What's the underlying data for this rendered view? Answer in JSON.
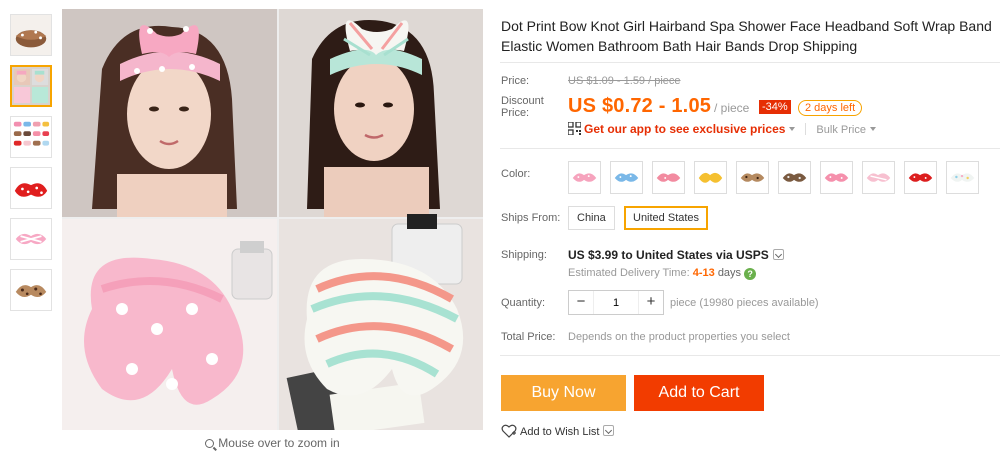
{
  "product": {
    "title": "Dot Print Bow Knot Girl Hairband Spa Shower Face Headband Soft Wrap Band Elastic Women Bathroom Bath Hair Bands Drop Shipping"
  },
  "gallery": {
    "thumbnails": [
      "pink-dot",
      "pink-mint",
      "grid",
      "red-dot",
      "pink-stripe",
      "leopard"
    ],
    "active_thumbnail": 1,
    "zoom_hint": "Mouse over to zoom in"
  },
  "price": {
    "label": "Price:",
    "original": "US $1.09 - 1.59 / piece",
    "discount_label": "Discount Price:",
    "discount_label_line1": "Discount",
    "discount_label_line2": "Price:",
    "current": "US $0.72 - 1.05",
    "unit": "/ piece",
    "discount_pct": "-34%",
    "days_left": "2 days left"
  },
  "promo": {
    "app_text": "Get our app to see exclusive prices",
    "bulk_text": "Bulk Price"
  },
  "color": {
    "label": "Color:",
    "options": [
      "pink-dot",
      "blue-dot",
      "pink-coral",
      "yellow-bow",
      "leopard",
      "leopard-dark",
      "pink-dot-2",
      "pink-white",
      "red-dot",
      "pastel"
    ]
  },
  "ships_from": {
    "label": "Ships From:",
    "options": [
      "China",
      "United States"
    ],
    "selected": "United States"
  },
  "shipping": {
    "label": "Shipping:",
    "value": "US $3.99 to United States via USPS",
    "delivery_label": "Estimated Delivery Time:",
    "delivery_days": "4-13",
    "delivery_unit": "days"
  },
  "quantity": {
    "label": "Quantity:",
    "value": "1",
    "minus": "−",
    "plus": "+",
    "note": "piece (19980 pieces available)"
  },
  "total": {
    "label": "Total Price:",
    "note": "Depends on the product properties you select"
  },
  "actions": {
    "buy_now": "Buy Now",
    "add_to_cart": "Add to Cart",
    "wish_list": "Add to Wish List"
  },
  "colors": {
    "accent_orange": "#f60",
    "buy_now_bg": "#f7a430",
    "add_cart_bg": "#f23c00",
    "discount_bg": "#e62e04",
    "selected_border": "#f7a400"
  }
}
